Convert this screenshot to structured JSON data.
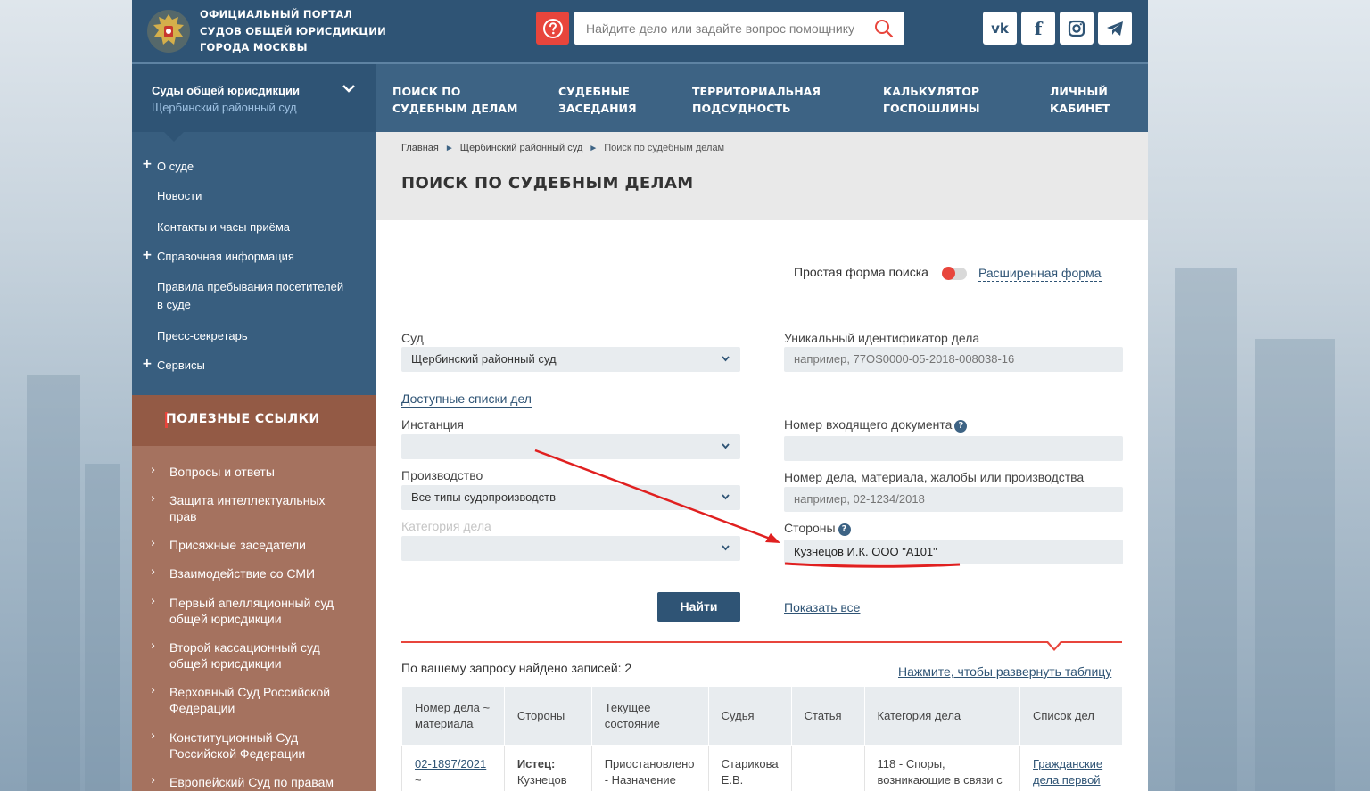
{
  "header": {
    "portal_title_lines": [
      "ОФИЦИАЛЬНЫЙ ПОРТАЛ",
      "СУДОВ ОБЩЕЙ ЮРИСДИКЦИИ",
      "ГОРОДА МОСКВЫ"
    ],
    "search_placeholder": "Найдите дело или задайте вопрос помощнику",
    "social": [
      "vk-icon",
      "facebook-icon",
      "instagram-icon",
      "telegram-icon"
    ]
  },
  "nav": {
    "court_select_title": "Суды общей юрисдикции",
    "court_select_value": "Щербинский районный суд",
    "items": [
      {
        "line1": "ПОИСК ПО",
        "line2": "СУДЕБНЫМ ДЕЛАМ"
      },
      {
        "line1": "СУДЕБНЫЕ",
        "line2": "ЗАСЕДАНИЯ"
      },
      {
        "line1": "ТЕРРИТОРИАЛЬНАЯ",
        "line2": "ПОДСУДНОСТЬ"
      },
      {
        "line1": "КАЛЬКУЛЯТОР",
        "line2": "ГОСПОШЛИНЫ"
      },
      {
        "line1": "ЛИЧНЫЙ",
        "line2": "КАБИНЕТ"
      }
    ]
  },
  "sidebar": {
    "items": [
      {
        "label": "О суде",
        "expandable": true
      },
      {
        "label": "Новости",
        "expandable": false
      },
      {
        "label": "Контакты и часы приёма",
        "expandable": false
      },
      {
        "label": "Справочная информация",
        "expandable": true
      },
      {
        "label": "Правила пребывания посетителей",
        "label2": "в суде",
        "expandable": false
      },
      {
        "label": "Пресс-секретарь",
        "expandable": false
      },
      {
        "label": "Сервисы",
        "expandable": true
      }
    ]
  },
  "useful_links": {
    "title": "ПОЛЕЗНЫЕ ССЫЛКИ",
    "items": [
      {
        "l1": "Вопросы и ответы"
      },
      {
        "l1": "Защита интеллектуальных",
        "l2": "прав"
      },
      {
        "l1": "Присяжные заседатели"
      },
      {
        "l1": "Взаимодействие со СМИ"
      },
      {
        "l1": "Первый апелляционный суд",
        "l2": "общей юрисдикции"
      },
      {
        "l1": "Второй кассационный суд",
        "l2": "общей юрисдикции"
      },
      {
        "l1": "Верховный Суд Российской",
        "l2": "Федерации"
      },
      {
        "l1": "Конституционный Суд",
        "l2": "Российской Федерации"
      },
      {
        "l1": "Европейский Суд по правам"
      }
    ]
  },
  "breadcrumb": [
    "Главная",
    "Щербинский районный суд",
    "Поиск по судебным делам"
  ],
  "page_title": "ПОИСК ПО СУДЕБНЫМ ДЕЛАМ",
  "form": {
    "simple_form_label": "Простая форма поиска",
    "advanced_form_link": "Расширенная форма",
    "court_label": "Суд",
    "court_value": "Щербинский районный суд",
    "uid_label": "Уникальный идентификатор дела",
    "uid_placeholder": "например, 77OS0000-05-2018-008038-16",
    "lists_link": "Доступные списки дел",
    "instance_label": "Инстанция",
    "incoming_doc_label": "Номер входящего документа",
    "proceeding_label": "Производство",
    "proceeding_value": "Все типы судопроизводств",
    "case_number_label": "Номер дела, материала, жалобы или производства",
    "case_number_placeholder": "например, 02-1234/2018",
    "category_label": "Категория дела",
    "parties_label": "Стороны",
    "parties_value": "Кузнецов И.К. ООО \"А101\"",
    "find_button": "Найти",
    "show_all_link": "Показать все"
  },
  "results": {
    "found_text": "По вашему запросу найдено записей: 2",
    "expand_link": "Нажмите, чтобы развернуть таблицу",
    "columns": [
      {
        "l1": "Номер дела ~",
        "l2": "материала"
      },
      {
        "l1": "Стороны"
      },
      {
        "l1": "Текущее",
        "l2": "состояние"
      },
      {
        "l1": "Судья"
      },
      {
        "l1": "Статья"
      },
      {
        "l1": "Категория дела"
      },
      {
        "l1": "Список дел"
      }
    ],
    "row1": {
      "case_number": "02-1897/2021",
      "case_suffix": "~",
      "parties_l1": "Истец:",
      "parties_l2": "Кузнецов",
      "state_l1": "Приостановлено",
      "state_l2": "- Назначение",
      "judge_l1": "Старикова",
      "judge_l2": "Е.В.",
      "article": "",
      "category_l1": "118 - Споры,",
      "category_l2": "возникающие в связи с",
      "list_l1": "Гражданские",
      "list_l2": "дела первой"
    }
  },
  "colors": {
    "header_bg": "#2f5475",
    "nav_bg": "#3d6384",
    "accent_red": "#e8453c",
    "useful_bg": "#a5725f"
  }
}
